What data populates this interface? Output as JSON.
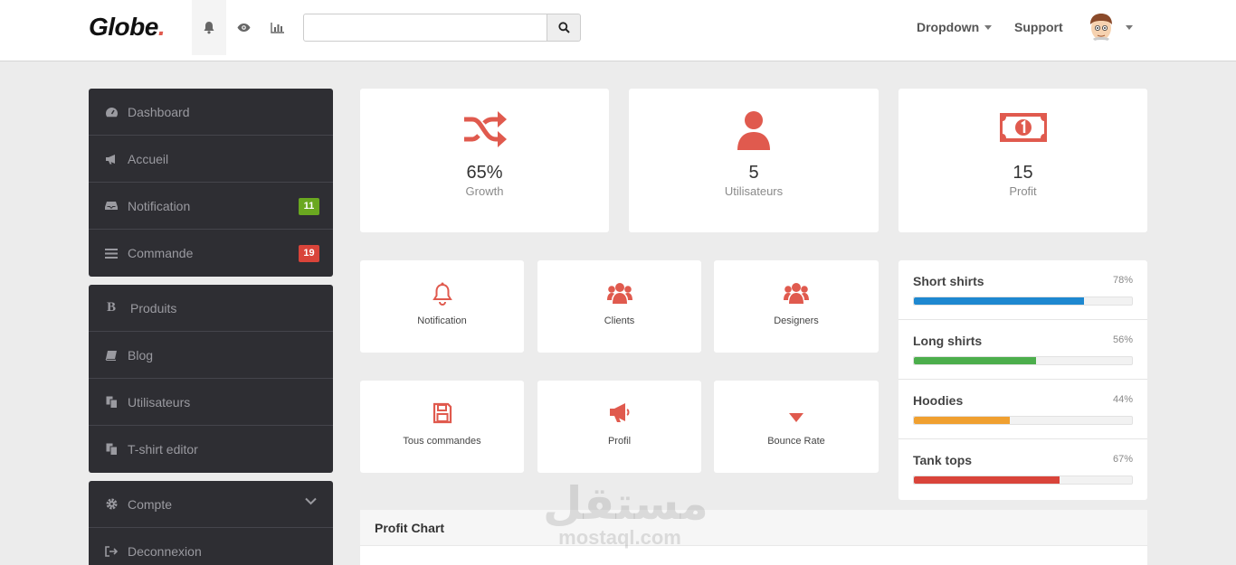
{
  "navbar": {
    "brand": "Globe",
    "brand_dot": ".",
    "search_placeholder": "",
    "dropdown_label": "Dropdown",
    "support_label": "Support",
    "icons": [
      "bell-icon",
      "eye-icon",
      "bar-chart-icon"
    ]
  },
  "sidebar": {
    "main": [
      {
        "label": "Dashboard",
        "icon": "dashboard-icon"
      },
      {
        "label": "Accueil",
        "icon": "bullhorn-icon"
      },
      {
        "label": "Notification",
        "icon": "inbox-icon",
        "badge": "11",
        "badge_color": "#6aa820"
      },
      {
        "label": "Commande",
        "icon": "list-icon",
        "badge": "19",
        "badge_color": "#d9443a"
      }
    ],
    "content": [
      {
        "label": "Produits",
        "icon": "bold-icon"
      },
      {
        "label": "Blog",
        "icon": "book-icon"
      },
      {
        "label": "Utilisateurs",
        "icon": "copy-icon"
      },
      {
        "label": "T-shirt editor",
        "icon": "copy-icon"
      }
    ],
    "account": [
      {
        "label": "Compte",
        "icon": "gear-icon"
      },
      {
        "label": "Deconnexion",
        "icon": "sign-out-icon"
      }
    ]
  },
  "stats": [
    {
      "value": "65%",
      "label": "Growth",
      "icon": "shuffle-icon"
    },
    {
      "value": "5",
      "label": "Utilisateurs",
      "icon": "user-icon"
    },
    {
      "value": "15",
      "label": "Profit",
      "icon": "money-icon"
    }
  ],
  "tiles": [
    {
      "label": "Notification",
      "icon": "bell-icon"
    },
    {
      "label": "Clients",
      "icon": "group-icon"
    },
    {
      "label": "Designers",
      "icon": "group-icon"
    },
    {
      "label": "Tous commandes",
      "icon": "save-icon"
    },
    {
      "label": "Profil",
      "icon": "bullhorn-icon"
    },
    {
      "label": "Bounce Rate",
      "icon": "caret-down-icon"
    }
  ],
  "progress": [
    {
      "name": "Short shirts",
      "pct": "78%",
      "value": 78,
      "color": "#1e88d0"
    },
    {
      "name": "Long shirts",
      "pct": "56%",
      "value": 56,
      "color": "#4cae4c"
    },
    {
      "name": "Hoodies",
      "pct": "44%",
      "value": 44,
      "color": "#f0a030"
    },
    {
      "name": "Tank tops",
      "pct": "67%",
      "value": 67,
      "color": "#d9443a"
    }
  ],
  "chart": {
    "title": "Profit Chart"
  },
  "watermark": {
    "arabic": "مستقل",
    "latin": "mostaql.com"
  },
  "colors": {
    "accent": "#e05a4e",
    "sidebar": "#2e2e33"
  }
}
